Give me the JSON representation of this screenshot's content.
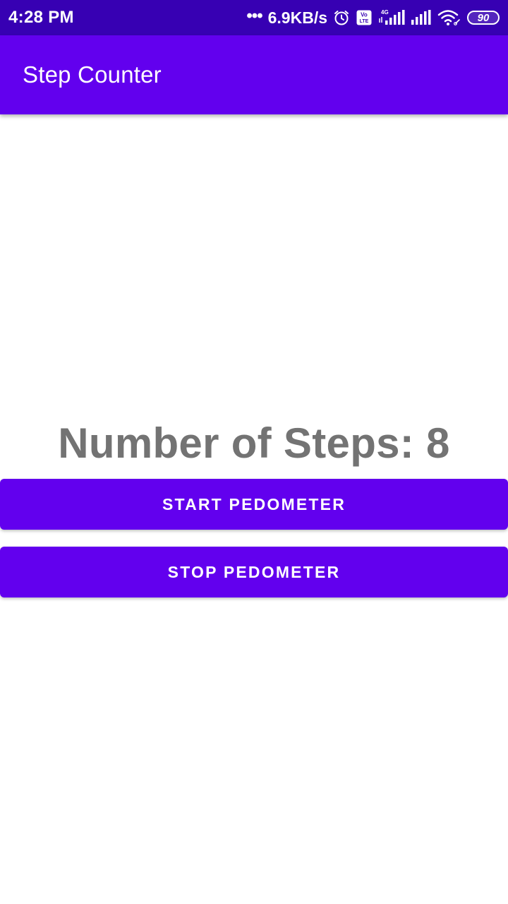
{
  "status_bar": {
    "time": "4:28 PM",
    "network_speed": "6.9KB/s",
    "volte_badge": "Vo LTE",
    "network_type": "4G",
    "battery_level": "90",
    "icons": [
      "alarm-icon",
      "volte-icon",
      "signal-4g-icon",
      "signal-icon",
      "wifi-icon",
      "battery-icon"
    ]
  },
  "app_bar": {
    "title": "Step Counter"
  },
  "main": {
    "steps_text": "Number of Steps: 8",
    "start_button_label": "START PEDOMETER",
    "stop_button_label": "STOP PEDOMETER"
  },
  "colors": {
    "status_bar": "#3700b3",
    "primary": "#6200ee",
    "steps_text": "#737373"
  }
}
